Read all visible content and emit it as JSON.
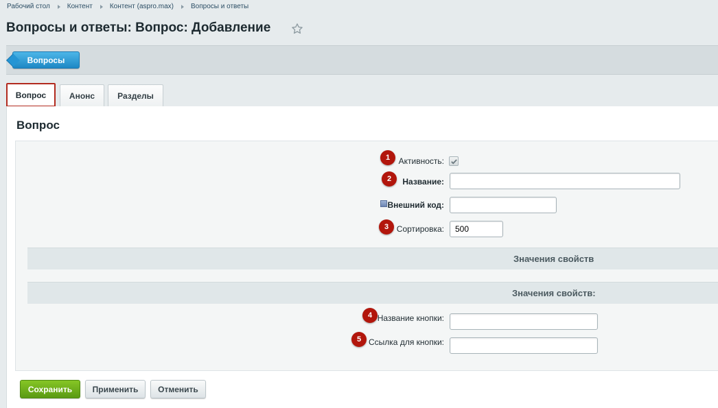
{
  "breadcrumb": [
    "Рабочий стол",
    "Контент",
    "Контент (aspro.max)",
    "Вопросы и ответы"
  ],
  "page_title": "Вопросы и ответы: Вопрос: Добавление",
  "toolbar": {
    "back_label": "Вопросы"
  },
  "tabs": [
    {
      "label": "Вопрос",
      "active": true
    },
    {
      "label": "Анонс",
      "active": false
    },
    {
      "label": "Разделы",
      "active": false
    }
  ],
  "section_title": "Вопрос",
  "form": {
    "active": {
      "badge": "1",
      "label": "Активность:",
      "checked": true
    },
    "name": {
      "badge": "2",
      "label": "Название:",
      "value": ""
    },
    "external_code": {
      "label": "Внешний код:",
      "value": ""
    },
    "sort": {
      "badge": "3",
      "label": "Сортировка:",
      "value": "500"
    }
  },
  "properties_header": "Значения свойств",
  "properties_header2": "Значения свойств:",
  "properties": {
    "button_name": {
      "badge": "4",
      "label": "Название кнопки:",
      "value": ""
    },
    "button_link": {
      "badge": "5",
      "label": "Ссылка для кнопки:",
      "value": ""
    }
  },
  "buttons": {
    "save": "Сохранить",
    "apply": "Применить",
    "cancel": "Отменить"
  },
  "colors": {
    "accent_blue": "#2595d4",
    "badge_red": "#b2160c",
    "save_green": "#6fae1c",
    "active_tab_border": "#b22a1e"
  },
  "icons": {
    "favorite": "star-outline-icon",
    "hint": "hint-square-icon",
    "check": "checkmark-icon"
  }
}
